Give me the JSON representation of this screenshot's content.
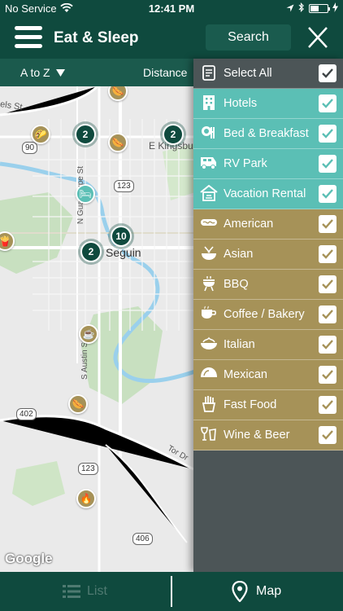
{
  "status": {
    "carrier": "No Service",
    "time": "12:41 PM"
  },
  "header": {
    "title": "Eat & Sleep",
    "search_label": "Search"
  },
  "sort": {
    "az_label": "A to Z",
    "distance_label": "Distance"
  },
  "map": {
    "street_els": "els St",
    "street_kingsbury": "E Kingsbury",
    "street_guadalupe": "N Guadalupe St",
    "street_austin": "S Austin St",
    "street_tordr": "Tor Dr",
    "city": "Seguin",
    "route_90": "90",
    "route_123a": "123",
    "route_123b": "123",
    "route_402": "402",
    "route_406": "406",
    "attribution": "Google",
    "clusters": [
      "2",
      "2",
      "10",
      "2"
    ]
  },
  "filters": [
    {
      "label": "Select All",
      "icon": "clipboard-icon",
      "checked": true
    },
    {
      "label": "Hotels",
      "icon": "hotel-icon",
      "checked": true
    },
    {
      "label": "Bed & Breakfast",
      "icon": "bed-breakfast-icon",
      "checked": true
    },
    {
      "label": "RV Park",
      "icon": "rv-icon",
      "checked": true
    },
    {
      "label": "Vacation Rental",
      "icon": "vacation-rental-icon",
      "checked": true
    },
    {
      "label": "American",
      "icon": "hotdog-icon",
      "checked": true
    },
    {
      "label": "Asian",
      "icon": "noodle-bowl-icon",
      "checked": true
    },
    {
      "label": "BBQ",
      "icon": "grill-icon",
      "checked": true
    },
    {
      "label": "Coffee / Bakery",
      "icon": "coffee-icon",
      "checked": true
    },
    {
      "label": "Italian",
      "icon": "pasta-icon",
      "checked": true
    },
    {
      "label": "Mexican",
      "icon": "taco-icon",
      "checked": true
    },
    {
      "label": "Fast Food",
      "icon": "fries-icon",
      "checked": true
    },
    {
      "label": "Wine & Beer",
      "icon": "wine-beer-icon",
      "checked": true
    }
  ],
  "tabs": {
    "list_label": "List",
    "map_label": "Map"
  },
  "colors": {
    "primary": "#0f4a3e",
    "lodging": "#5bbfb5",
    "dining": "#a69258",
    "panel": "#4c5557"
  }
}
